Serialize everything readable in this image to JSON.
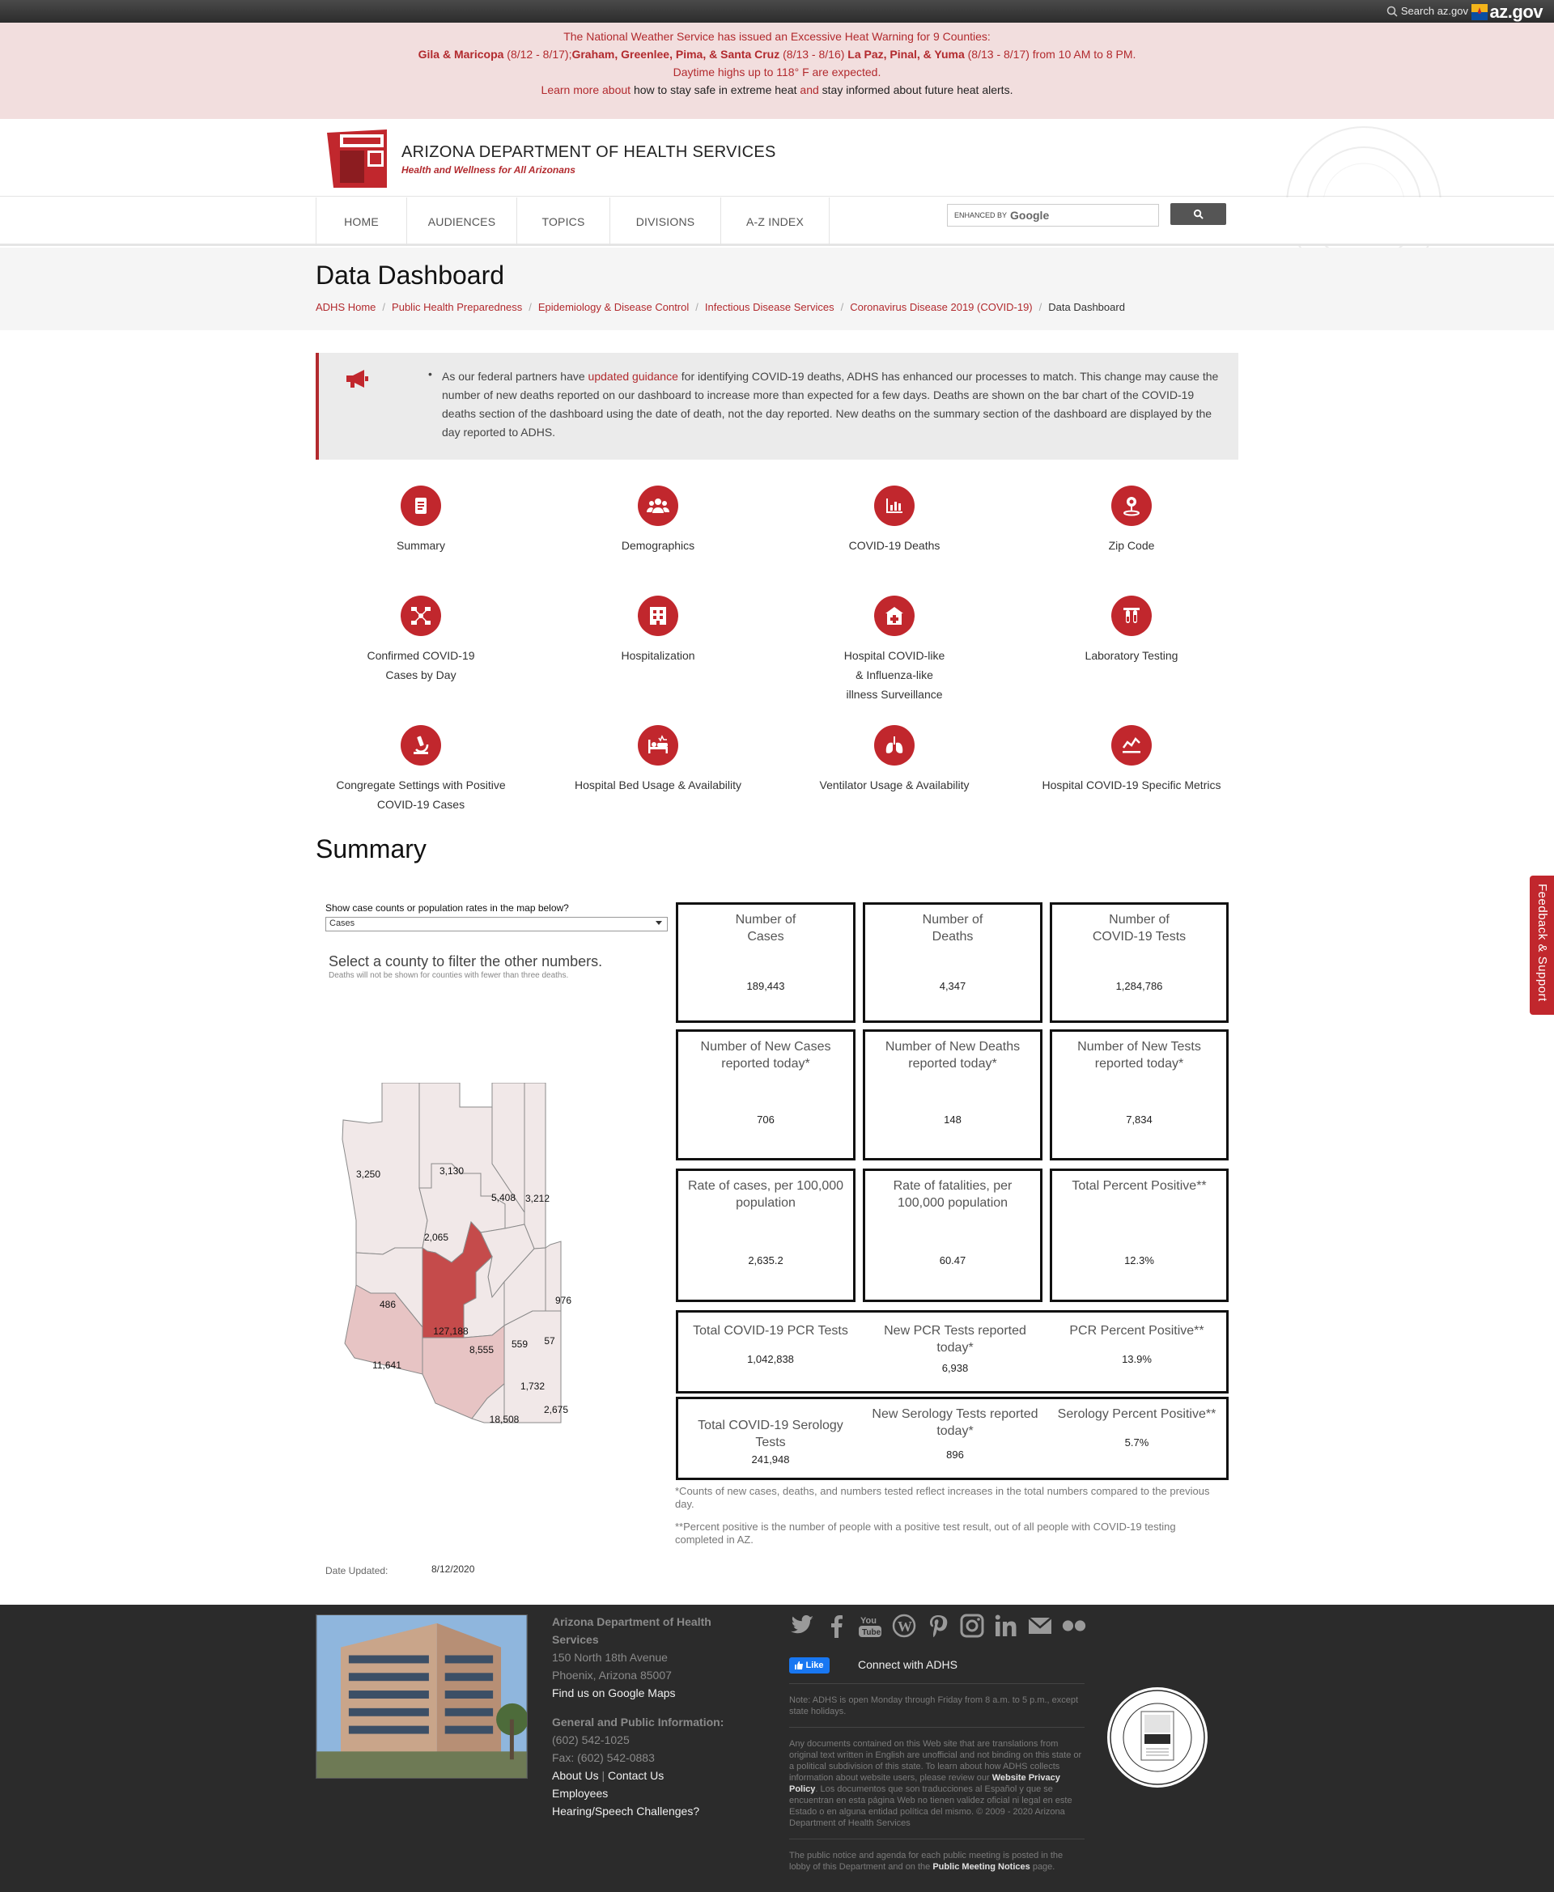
{
  "topbar": {
    "search_label": "Search az.gov",
    "brand": "az.gov"
  },
  "alert": {
    "line1": "The National Weather Service has issued an Excessive Heat Warning for 9 Counties:",
    "line2_a": "Gila & Maricopa",
    "line2_b": " (8/12 - 8/17);",
    "line2_c": "Graham, Greenlee, Pima, & Santa Cruz",
    "line2_d": " (8/13 - 8/16) ",
    "line2_e": "La Paz, Pinal, & Yuma",
    "line2_f": " (8/13 - 8/17) from 10 AM to 8 PM.",
    "line3": "Daytime highs up to 118° F are expected.",
    "line4_a": "Learn more about",
    "line4_b": " how to stay safe in extreme heat ",
    "line4_c": "and",
    "line4_d": " stay informed about future heat alerts."
  },
  "header": {
    "org_name": "ARIZONA DEPARTMENT OF HEALTH SERVICES",
    "tagline": "Health and Wellness for All Arizonans"
  },
  "nav": {
    "items": [
      "HOME",
      "AUDIENCES",
      "TOPICS",
      "DIVISIONS",
      "A-Z INDEX"
    ],
    "search_prefix": "ENHANCED BY",
    "search_brand": "Google"
  },
  "page": {
    "title": "Data Dashboard",
    "breadcrumb": [
      "ADHS Home",
      "Public Health Preparedness",
      "Epidemiology & Disease Control",
      "Infectious Disease Services",
      "Coronavirus Disease 2019 (COVID-19)",
      "Data Dashboard"
    ]
  },
  "notice": {
    "pre": "As our federal partners have ",
    "link": "updated guidance",
    "post": " for identifying COVID-19 deaths, ADHS has enhanced our processes to match. This change may cause the number of new deaths reported on our dashboard to increase more than expected for a few days. Deaths are shown on the bar chart of the COVID-19 deaths section of the dashboard using the date of death, not the day reported. New deaths on the summary section of the dashboard are displayed by the day reported to ADHS."
  },
  "tiles": [
    {
      "label": "Summary",
      "icon": "document-icon"
    },
    {
      "label": "Demographics",
      "icon": "people-icon"
    },
    {
      "label": "COVID-19 Deaths",
      "icon": "bar-chart-icon"
    },
    {
      "label": "Zip Code",
      "icon": "location-pin-icon"
    },
    {
      "label": "Confirmed COVID-19\nCases by Day",
      "icon": "network-icon"
    },
    {
      "label": "Hospitalization",
      "icon": "hospital-building-icon"
    },
    {
      "label": "Hospital COVID-like\n& Influenza-like\nillness Surveillance",
      "icon": "clinic-icon"
    },
    {
      "label": "Laboratory Testing",
      "icon": "test-tubes-icon"
    },
    {
      "label": "Congregate Settings with Positive\nCOVID-19 Cases",
      "icon": "microscope-icon"
    },
    {
      "label": "Hospital Bed Usage & Availability",
      "icon": "hospital-bed-icon"
    },
    {
      "label": "Ventilator Usage & Availability",
      "icon": "lungs-icon"
    },
    {
      "label": "Hospital COVID-19 Specific Metrics",
      "icon": "trend-chart-icon"
    }
  ],
  "summary": {
    "title": "Summary",
    "filter_label": "Show case counts or population rates in the map below?",
    "filter_value": "Cases",
    "select_hint": "Select a county to filter the other numbers.",
    "select_note": "Deaths will not be shown for counties with fewer than three deaths."
  },
  "map": {
    "counties": [
      {
        "name": "Mohave",
        "value": "3,250"
      },
      {
        "name": "Coconino",
        "value": "3,130"
      },
      {
        "name": "Navajo",
        "value": "5,408"
      },
      {
        "name": "Apache",
        "value": "3,212"
      },
      {
        "name": "Yavapai",
        "value": "2,065"
      },
      {
        "name": "La Paz",
        "value": "486"
      },
      {
        "name": "Maricopa",
        "value": "127,188"
      },
      {
        "name": "Gila",
        "value": "976"
      },
      {
        "name": "Pinal",
        "value": "8,555"
      },
      {
        "name": "Graham",
        "value": "559"
      },
      {
        "name": "Greenlee",
        "value": "57"
      },
      {
        "name": "Yuma",
        "value": "11,641"
      },
      {
        "name": "Pima",
        "value": "18,508"
      },
      {
        "name": "Cochise",
        "value": "1,732"
      },
      {
        "name": "Santa Cruz",
        "value": "2,675"
      }
    ],
    "colors": {
      "high": "#c54b4b",
      "mid": "#e7c4c4",
      "low": "#f1e8e8",
      "border": "#8a8a8a"
    }
  },
  "stats": {
    "cases": {
      "title": "Number of\nCases",
      "value": "189,443"
    },
    "deaths": {
      "title": "Number of\nDeaths",
      "value": "4,347"
    },
    "tests": {
      "title": "Number of\nCOVID-19 Tests",
      "value": "1,284,786"
    },
    "new_cases": {
      "title": "Number of New Cases\nreported today*",
      "value": "706"
    },
    "new_deaths": {
      "title": "Number of New Deaths\nreported today*",
      "value": "148"
    },
    "new_tests": {
      "title": "Number of New Tests\nreported today*",
      "value": "7,834"
    },
    "case_rate": {
      "title": "Rate of cases, per 100,000\npopulation",
      "value": "2,635.2"
    },
    "fatality_rate": {
      "title": "Rate of fatalities, per\n100,000 population",
      "value": "60.47"
    },
    "pct_positive": {
      "title": "Total Percent Positive**",
      "value": "12.3%"
    },
    "pcr_total": {
      "title": "Total COVID-19 PCR Tests",
      "value": "1,042,838"
    },
    "pcr_new": {
      "title": "New PCR Tests reported\ntoday*",
      "value": "6,938"
    },
    "pcr_pct": {
      "title": "PCR Percent Positive**",
      "value": "13.9%"
    },
    "sero_total": {
      "title": "Total COVID-19 Serology\nTests",
      "value": "241,948"
    },
    "sero_new": {
      "title": "New Serology Tests reported\ntoday*",
      "value": "896"
    },
    "sero_pct": {
      "title": "Serology Percent Positive**",
      "value": "5.7%"
    }
  },
  "footnotes": {
    "one": "*Counts of new cases, deaths, and numbers tested reflect increases in the total numbers compared to the previous day.",
    "two": "**Percent positive is the number of people with a positive test result, out of all people with COVID-19 testing completed in AZ."
  },
  "date": {
    "label": "Date Updated:",
    "value": "8/12/2020"
  },
  "feedback": "Feedback & Support",
  "footer": {
    "org": "Arizona Department of Health Services",
    "street": "150 North 18th Avenue",
    "city": "Phoenix, Arizona 85007",
    "maps_link": "Find us on Google Maps",
    "info_heading": "General and Public Information:",
    "phone": "(602) 542-1025",
    "fax": "Fax: (602) 542-0883",
    "about": "About Us",
    "contact": "Contact Us",
    "employees": "Employees",
    "hearing": "Hearing/Speech Challenges?",
    "like": "Like",
    "connect": "Connect with ADHS",
    "hours_note": "Note: ADHS is open Monday through Friday from 8 a.m. to 5 p.m., except state holidays.",
    "translation_pre": "Any documents contained on this Web site that are translations from original text written in English are unofficial and not binding on this state or a political subdivision of this state. To learn about how ADHS collects information about website users, please review our ",
    "privacy_link": "Website Privacy Policy",
    "translation_post": ". Los documentos que son traducciones al Español y que se encuentran en esta página Web no tienen validez oficial ni legal en este Estado o en alguna entidad política del mismo. © 2009 - 2020 Arizona Department of Health Services",
    "meeting_pre": "The public notice and agenda for each public meeting is posted in the lobby of this Department and on the ",
    "meeting_link": "Public Meeting Notices",
    "meeting_post": " page.",
    "social_icons": [
      "twitter-icon",
      "facebook-icon",
      "youtube-icon",
      "wordpress-icon",
      "pinterest-icon",
      "instagram-icon",
      "linkedin-icon",
      "email-icon",
      "flickr-icon"
    ]
  }
}
